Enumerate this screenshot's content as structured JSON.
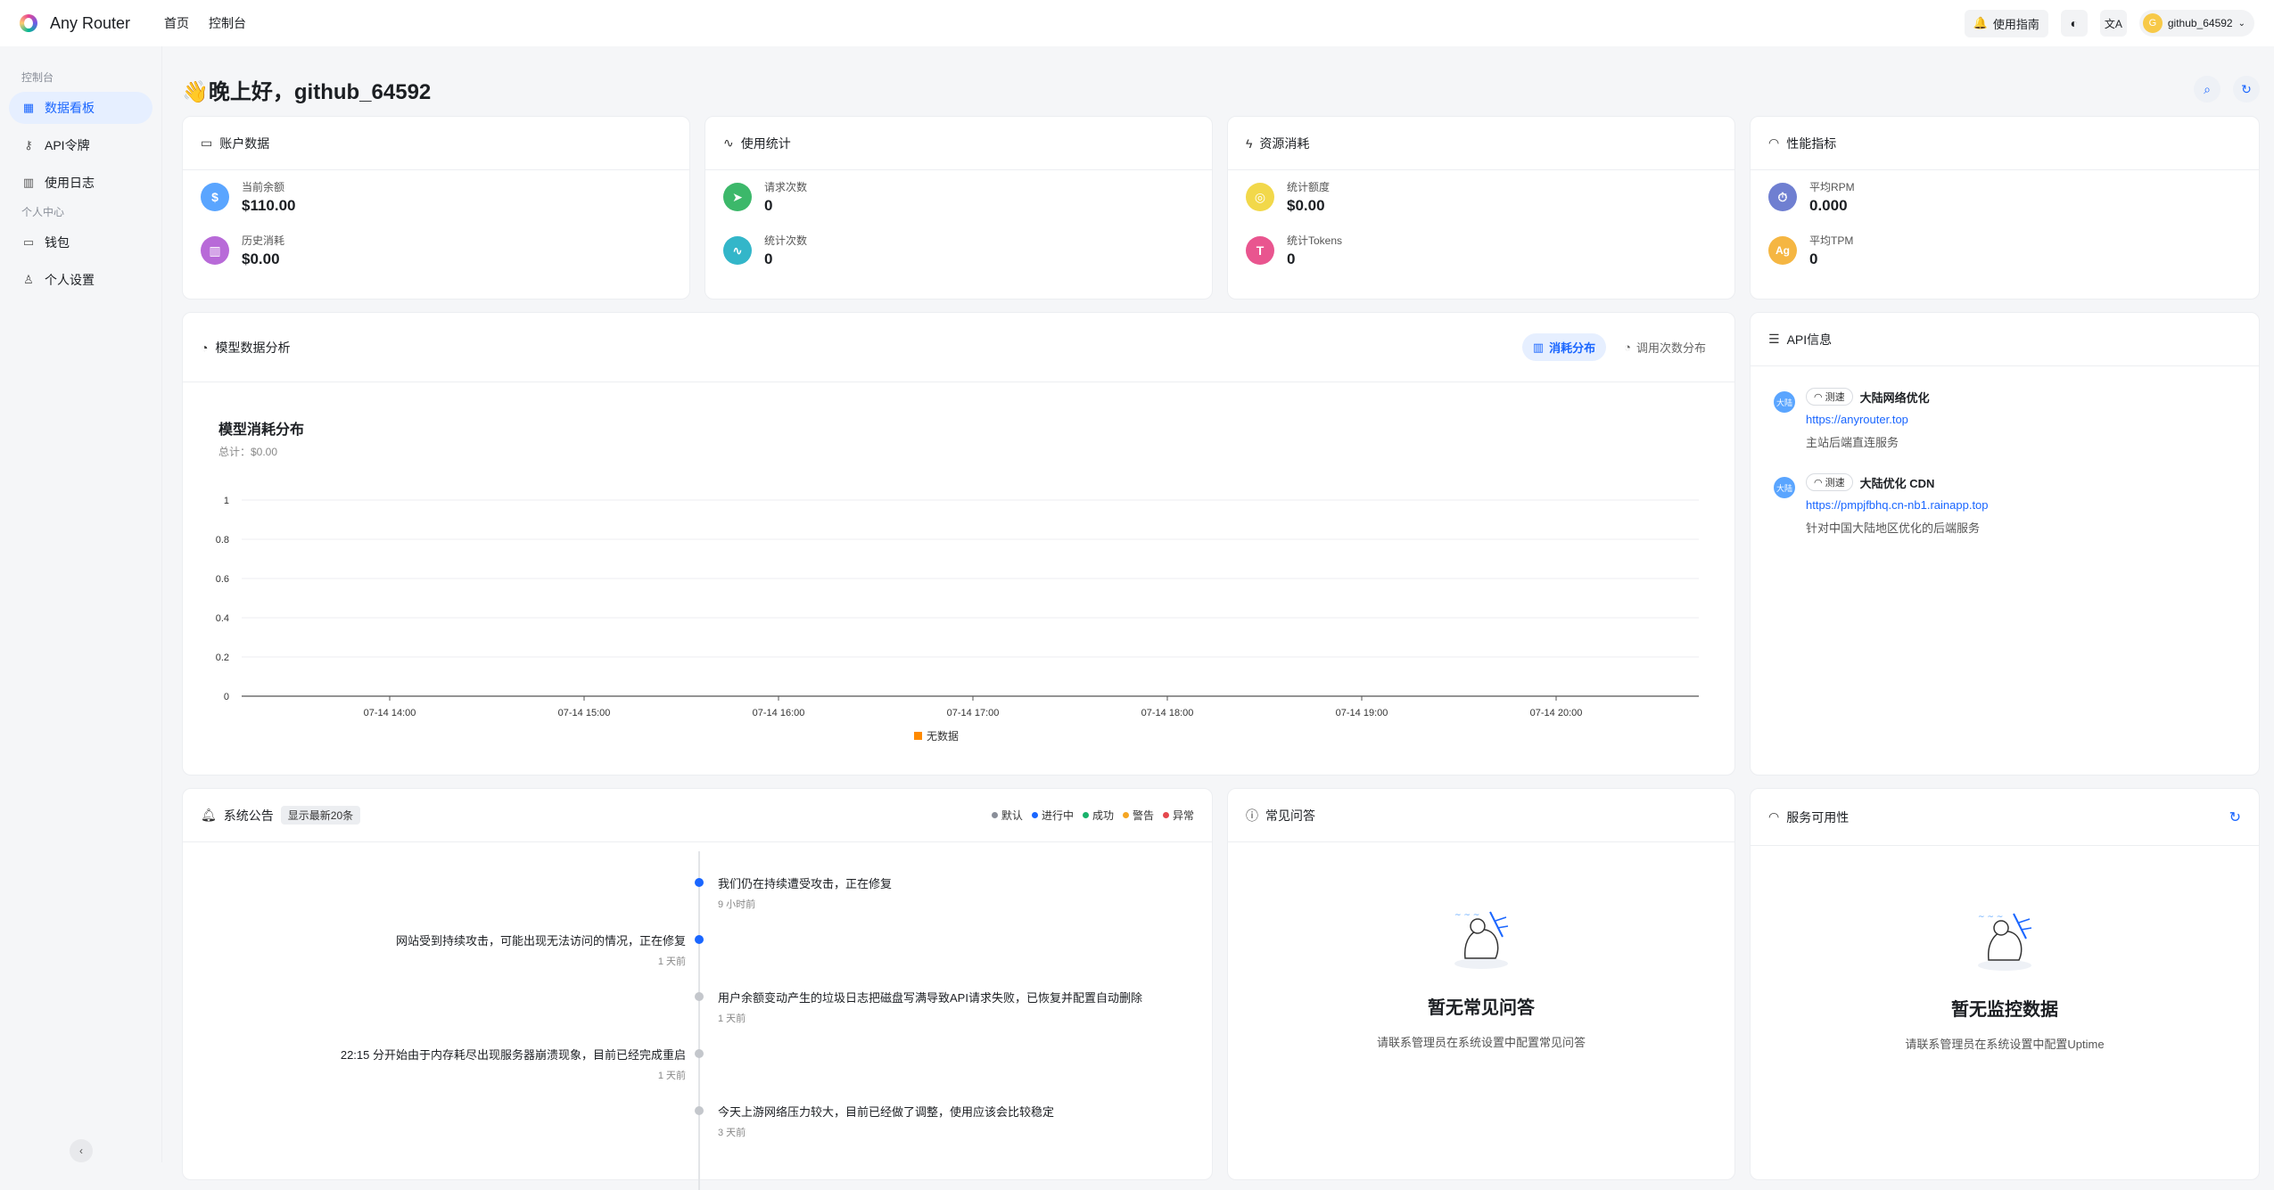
{
  "app": {
    "name": "Any Router"
  },
  "topnav": {
    "home": "首页",
    "console": "控制台"
  },
  "topright": {
    "guide": "使用指南",
    "user": "github_64592",
    "avatar_letter": "G"
  },
  "sidebar": {
    "section1": "控制台",
    "items1": [
      {
        "label": "数据看板",
        "icon": "dashboard-icon"
      },
      {
        "label": "API令牌",
        "icon": "key-icon"
      },
      {
        "label": "使用日志",
        "icon": "chart-icon"
      }
    ],
    "section2": "个人中心",
    "items2": [
      {
        "label": "钱包",
        "icon": "wallet-icon"
      },
      {
        "label": "个人设置",
        "icon": "user-icon"
      }
    ]
  },
  "greeting": "👋晚上好，github_64592",
  "cards": {
    "account": {
      "title": "账户数据",
      "s1_label": "当前余额",
      "s1_value": "$110.00",
      "s2_label": "历史消耗",
      "s2_value": "$0.00"
    },
    "usage": {
      "title": "使用统计",
      "s1_label": "请求次数",
      "s1_value": "0",
      "s2_label": "统计次数",
      "s2_value": "0"
    },
    "resource": {
      "title": "资源消耗",
      "s1_label": "统计额度",
      "s1_value": "$0.00",
      "s2_label": "统计Tokens",
      "s2_value": "0"
    },
    "perf": {
      "title": "性能指标",
      "s1_label": "平均RPM",
      "s1_value": "0.000",
      "s2_label": "平均TPM",
      "s2_value": "0"
    }
  },
  "model_panel": {
    "title": "模型数据分析",
    "tab1": "消耗分布",
    "tab2": "调用次数分布"
  },
  "chart_data": {
    "type": "bar",
    "title": "模型消耗分布",
    "subtitle": "总计：$0.00",
    "categories": [
      "07-14 14:00",
      "07-14 15:00",
      "07-14 16:00",
      "07-14 17:00",
      "07-14 18:00",
      "07-14 19:00",
      "07-14 20:00"
    ],
    "series": [
      {
        "name": "无数据",
        "values": [
          0,
          0,
          0,
          0,
          0,
          0,
          0
        ],
        "color": "#ff8a00"
      }
    ],
    "yticks": [
      "0",
      "0.2",
      "0.4",
      "0.6",
      "0.8",
      "1"
    ],
    "ylim": [
      0,
      1
    ],
    "grid": true,
    "legend": "bottom"
  },
  "api_panel": {
    "title": "API信息",
    "speed_label": "测速",
    "badge": "大陆",
    "items": [
      {
        "name": "大陆网络优化",
        "url": "https://anyrouter.top",
        "desc": "主站后端直连服务"
      },
      {
        "name": "大陆优化 CDN",
        "url": "https://pmpjfbhq.cn-nb1.rainapp.top",
        "desc": "针对中国大陆地区优化的后端服务"
      }
    ]
  },
  "notice_panel": {
    "title": "系统公告",
    "tag": "显示最新20条",
    "legend": [
      {
        "label": "默认",
        "color": "#8a8f99"
      },
      {
        "label": "进行中",
        "color": "#1a66ff"
      },
      {
        "label": "成功",
        "color": "#19b26b"
      },
      {
        "label": "警告",
        "color": "#f5a623"
      },
      {
        "label": "异常",
        "color": "#e5484d"
      }
    ],
    "items": [
      {
        "text": "我们仍在持续遭受攻击，正在修复",
        "time": "9 小时前"
      },
      {
        "text": "网站受到持续攻击，可能出现无法访问的情况，正在修复",
        "time": "1 天前"
      },
      {
        "text": "用户余额变动产生的垃圾日志把磁盘写满导致API请求失败，已恢复并配置自动删除",
        "time": "1 天前"
      },
      {
        "text": "22:15 分开始由于内存耗尽出现服务器崩溃现象，目前已经完成重启",
        "time": "1 天前"
      },
      {
        "text": "今天上游网络压力较大，目前已经做了调整，使用应该会比较稳定",
        "time": "3 天前"
      }
    ]
  },
  "faq_panel": {
    "title": "常见问答",
    "empty_title": "暂无常见问答",
    "empty_desc": "请联系管理员在系统设置中配置常见问答"
  },
  "uptime_panel": {
    "title": "服务可用性",
    "empty_title": "暂无监控数据",
    "empty_desc": "请联系管理员在系统设置中配置Uptime"
  }
}
